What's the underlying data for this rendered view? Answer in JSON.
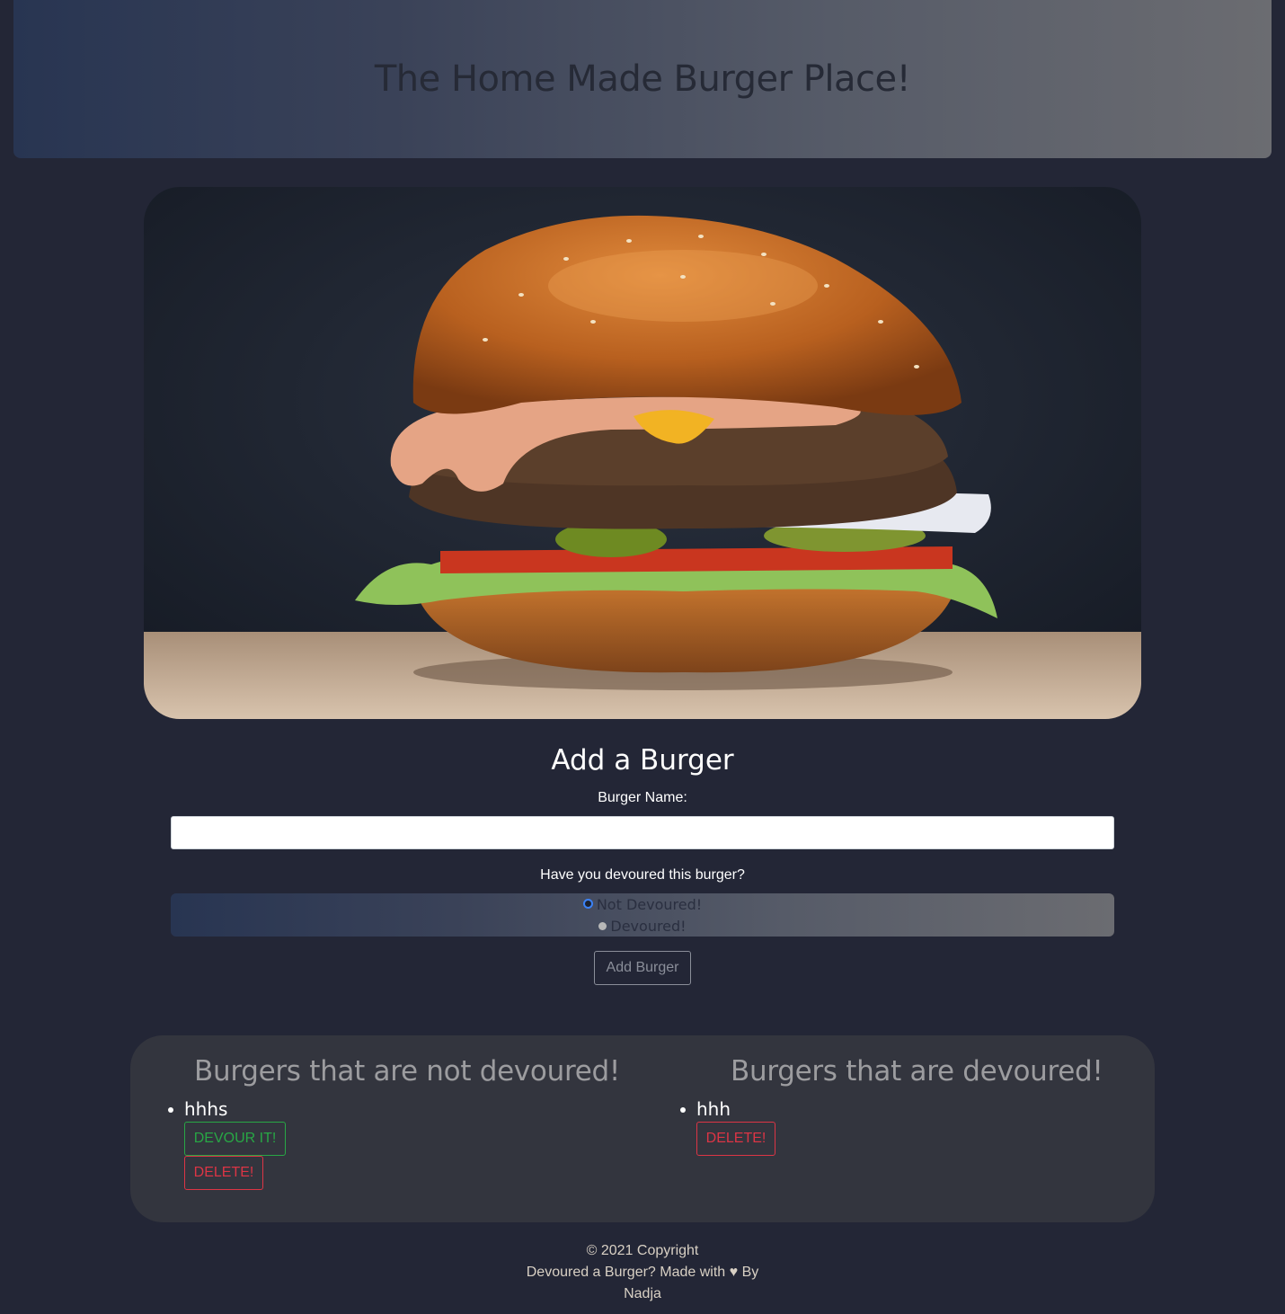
{
  "header": {
    "title": "The Home Made Burger Place!"
  },
  "hero": {
    "alt": "Burger photo"
  },
  "form": {
    "title": "Add a Burger",
    "name_label": "Burger Name:",
    "name_value": "",
    "name_placeholder": "",
    "devoured_question": "Have you devoured this burger?",
    "options": [
      {
        "label": "Not Devoured!",
        "selected": true
      },
      {
        "label": "Devoured!",
        "selected": false
      }
    ],
    "submit_label": "Add Burger"
  },
  "lists": {
    "not_devoured": {
      "title": "Burgers that are not devoured!",
      "items": [
        {
          "name": "hhhs",
          "devour_label": "DEVOUR IT!",
          "delete_label": "DELETE!"
        }
      ]
    },
    "devoured": {
      "title": "Burgers that are devoured!",
      "items": [
        {
          "name": "hhh",
          "delete_label": "DELETE!"
        }
      ]
    }
  },
  "footer": {
    "line1": "© 2021 Copyright",
    "line2": "Devoured a Burger? Made with ♥ By",
    "line3": "Nadja"
  },
  "colors": {
    "background": "#232636",
    "success": "#28a745",
    "danger": "#dc3545"
  }
}
